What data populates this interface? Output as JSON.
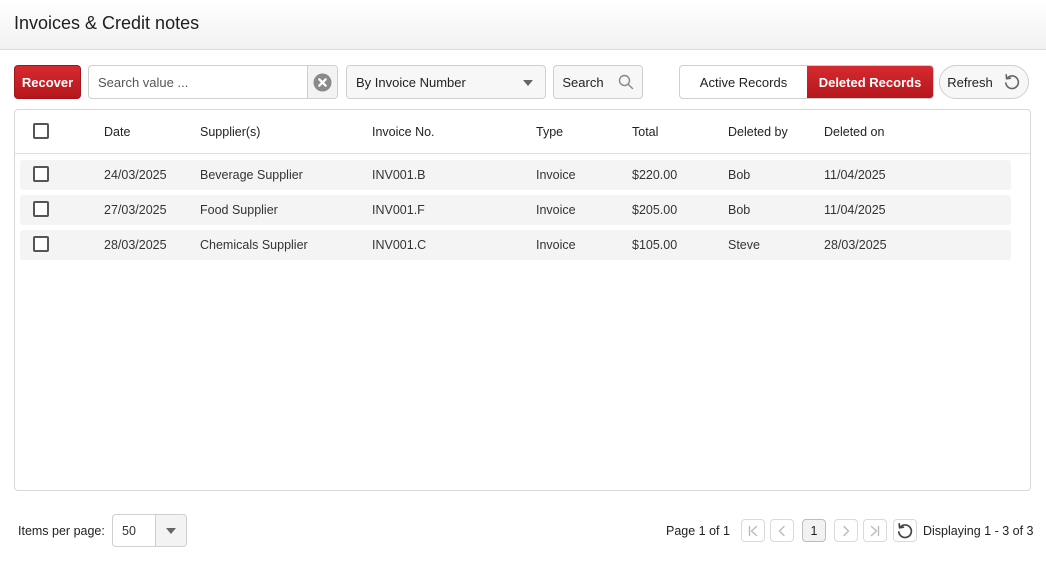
{
  "header": {
    "title": "Invoices & Credit notes"
  },
  "toolbar": {
    "recover_label": "Recover",
    "search_placeholder": "Search value ...",
    "search_value": "",
    "search_by": "By Invoice Number",
    "search_label": "Search",
    "active_records_label": "Active Records",
    "deleted_records_label": "Deleted Records",
    "refresh_label": "Refresh"
  },
  "table": {
    "columns": [
      "Date",
      "Supplier(s)",
      "Invoice No.",
      "Type",
      "Total",
      "Deleted by",
      "Deleted on"
    ],
    "rows": [
      {
        "date": "24/03/2025",
        "supplier": "Beverage Supplier",
        "invoice_no": "INV001.B",
        "type": "Invoice",
        "total": "$220.00",
        "deleted_by": "Bob",
        "deleted_on": "11/04/2025"
      },
      {
        "date": "27/03/2025",
        "supplier": "Food Supplier",
        "invoice_no": "INV001.F",
        "type": "Invoice",
        "total": "$205.00",
        "deleted_by": "Bob",
        "deleted_on": "11/04/2025"
      },
      {
        "date": "28/03/2025",
        "supplier": "Chemicals Supplier",
        "invoice_no": "INV001.C",
        "type": "Invoice",
        "total": "$105.00",
        "deleted_by": "Steve",
        "deleted_on": "28/03/2025"
      }
    ]
  },
  "pager": {
    "items_per_page_label": "Items per page:",
    "items_per_page": "50",
    "page_info": "Page 1 of 1",
    "current_page": "1",
    "display_info": "Displaying 1 - 3 of 3"
  },
  "colors": {
    "accent": "#c41e24",
    "row_bg": "#f4f4f4",
    "border": "#d8d8d8"
  },
  "icons": [
    "clear-icon",
    "search-icon",
    "refresh-icon",
    "first-page-icon",
    "prev-page-icon",
    "next-page-icon",
    "last-page-icon",
    "reload-icon"
  ]
}
